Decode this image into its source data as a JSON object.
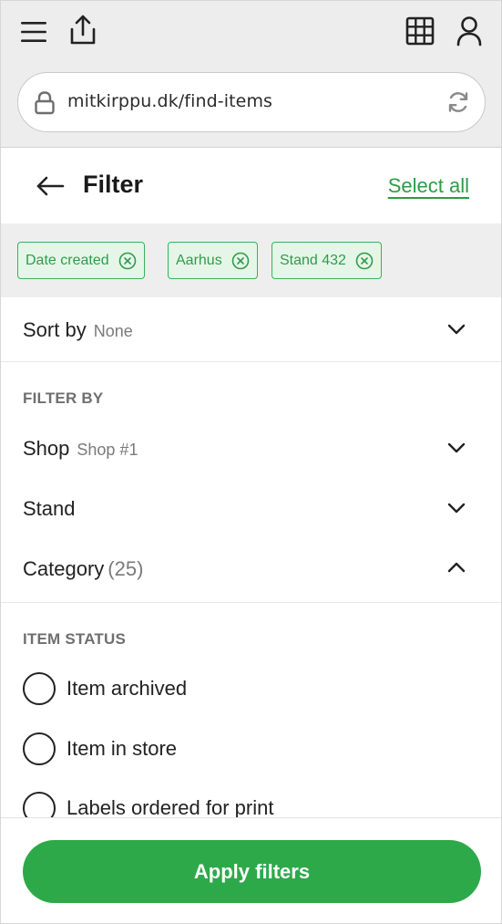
{
  "browser": {
    "url": "mitkirppu.dk/find-items",
    "icons": [
      "menu-icon",
      "share-icon",
      "grid-icon",
      "user-icon",
      "lock-icon",
      "reload-icon"
    ]
  },
  "header": {
    "title": "Filter",
    "select_all": "Select all"
  },
  "chips": [
    {
      "label": "Date created"
    },
    {
      "label": "Aarhus"
    },
    {
      "label": "Stand 432"
    }
  ],
  "sort": {
    "label": "Sort by",
    "value": "None"
  },
  "filter_by": {
    "title": "FILTER BY",
    "shop": {
      "label": "Shop",
      "value": "Shop #1"
    },
    "stand": {
      "label": "Stand"
    },
    "category": {
      "label": "Category",
      "count": "(25)"
    }
  },
  "item_status": {
    "title": "ITEM STATUS",
    "options": [
      {
        "label": "Item archived"
      },
      {
        "label": "Item in store"
      },
      {
        "label": "Labels ordered for print"
      }
    ]
  },
  "footer": {
    "apply_label": "Apply filters"
  },
  "colors": {
    "accent": "#2ea94a",
    "chip_bg": "#e5f6e8",
    "chip_border": "#39b157"
  }
}
